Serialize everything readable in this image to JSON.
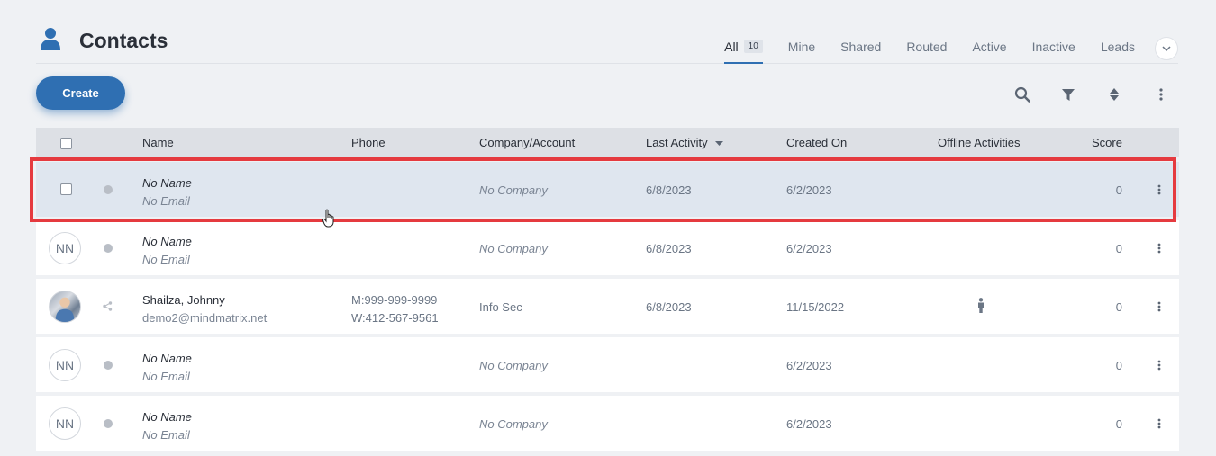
{
  "page": {
    "title": "Contacts",
    "title_icon": "user-icon"
  },
  "tabs": [
    {
      "label": "All",
      "badge": "10",
      "active": true
    },
    {
      "label": "Mine"
    },
    {
      "label": "Shared"
    },
    {
      "label": "Routed"
    },
    {
      "label": "Active"
    },
    {
      "label": "Inactive"
    },
    {
      "label": "Leads"
    }
  ],
  "toolbar": {
    "create_label": "Create",
    "icons": [
      "search-icon",
      "filter-icon",
      "sort-icon",
      "more-vertical-icon"
    ]
  },
  "table": {
    "columns": {
      "name": "Name",
      "phone": "Phone",
      "company": "Company/Account",
      "last_activity": "Last Activity",
      "created_on": "Created On",
      "offline_activities": "Offline Activities",
      "score": "Score"
    },
    "sort_column": "Last Activity",
    "rows": [
      {
        "avatar": "",
        "name": "No Name",
        "email": "No Email",
        "phone1": "",
        "phone2": "",
        "company": "No Company",
        "last_activity": "6/8/2023",
        "created_on": "6/2/2023",
        "score": "0",
        "selected": true
      },
      {
        "avatar": "NN",
        "name": "No Name",
        "email": "No Email",
        "phone1": "",
        "phone2": "",
        "company": "No Company",
        "last_activity": "6/8/2023",
        "created_on": "6/2/2023",
        "score": "0"
      },
      {
        "avatar": "photo",
        "name": "Shailza, Johnny",
        "email": "demo2@mindmatrix.net",
        "phone1": "M:999-999-9999",
        "phone2": "W:412-567-9561",
        "company": "Info Sec",
        "last_activity": "6/8/2023",
        "created_on": "11/15/2022",
        "score": "0",
        "offline_icon": "person-icon",
        "status_icon": "share-icon"
      },
      {
        "avatar": "NN",
        "name": "No Name",
        "email": "No Email",
        "phone1": "",
        "phone2": "",
        "company": "No Company",
        "last_activity": "",
        "created_on": "6/2/2023",
        "score": "0"
      },
      {
        "avatar": "NN",
        "name": "No Name",
        "email": "No Email",
        "phone1": "",
        "phone2": "",
        "company": "No Company",
        "last_activity": "",
        "created_on": "6/2/2023",
        "score": "0"
      }
    ]
  },
  "colors": {
    "accent": "#2f6fb2",
    "highlight": "#e53a3f",
    "background": "#eff1f4"
  }
}
